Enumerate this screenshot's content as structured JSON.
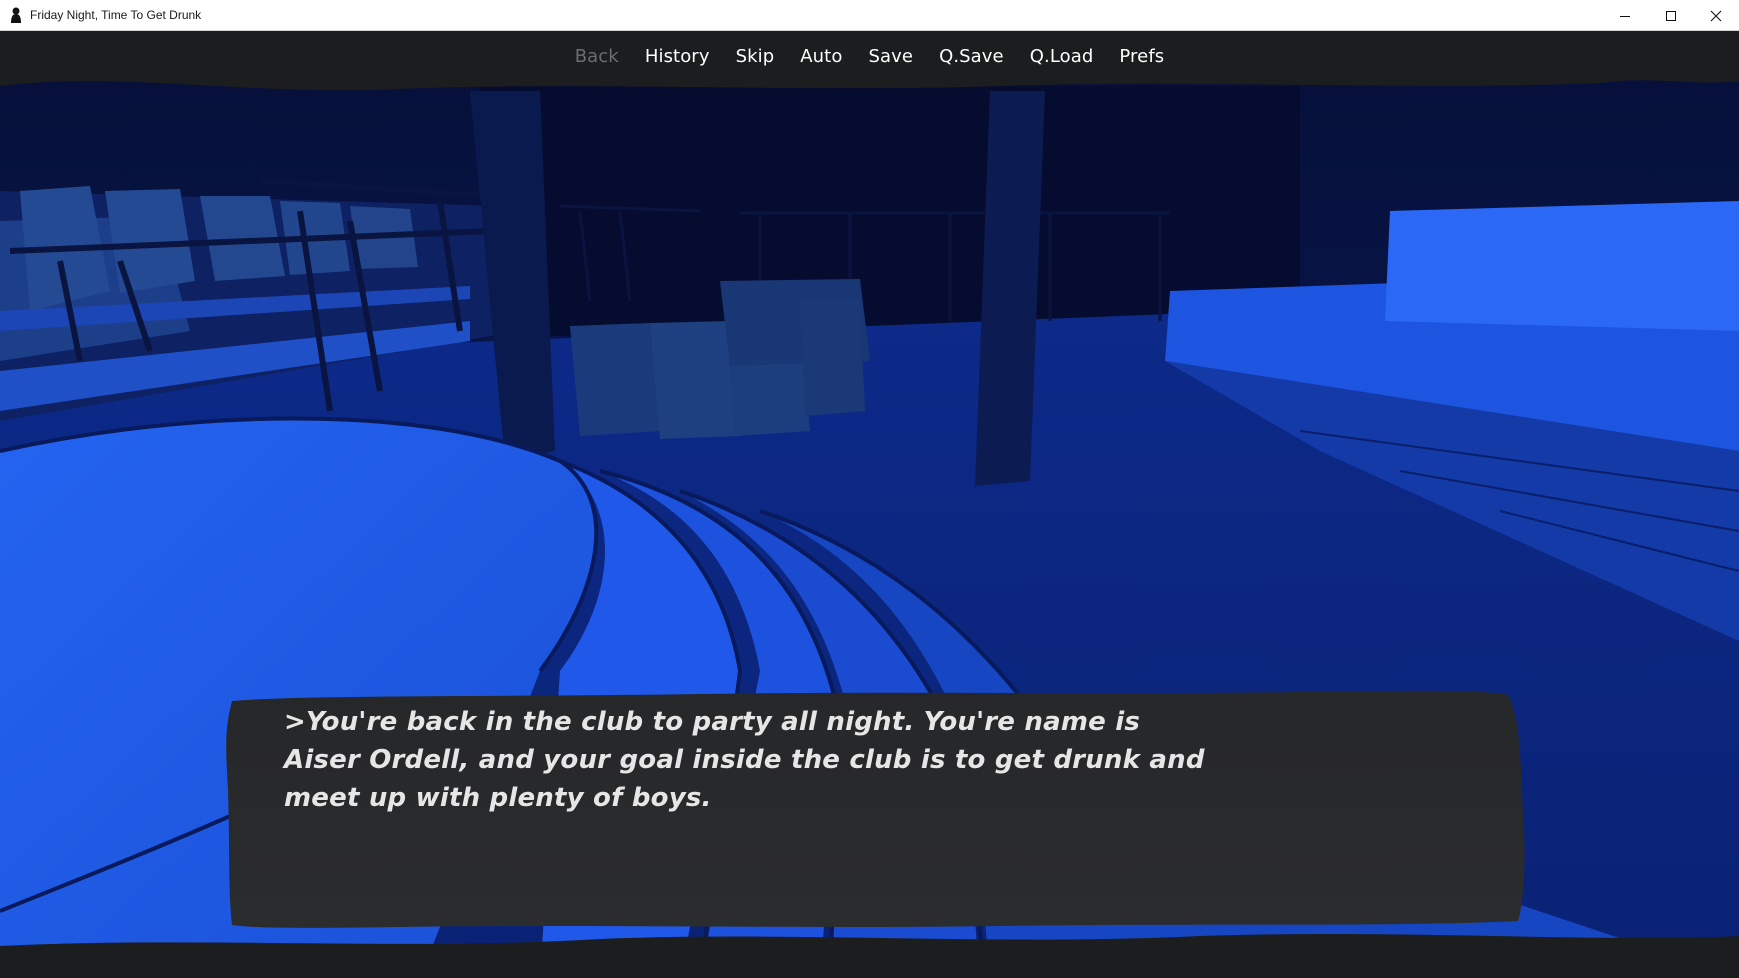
{
  "window": {
    "title": "Friday Night, Time To Get Drunk",
    "icons": {
      "app": "app-silhouette-icon",
      "minimize": "minimize-icon",
      "maximize": "maximize-icon",
      "close": "close-icon"
    }
  },
  "quick_menu": {
    "items": [
      {
        "label": "Back",
        "enabled": false
      },
      {
        "label": "History",
        "enabled": true
      },
      {
        "label": "Skip",
        "enabled": true
      },
      {
        "label": "Auto",
        "enabled": true
      },
      {
        "label": "Save",
        "enabled": true
      },
      {
        "label": "Q.Save",
        "enabled": true
      },
      {
        "label": "Q.Load",
        "enabled": true
      },
      {
        "label": "Prefs",
        "enabled": true
      }
    ]
  },
  "dialogue": {
    "text": ">You're back in the club to party all night. You're name is Aiser Ordell, and your goal inside the club is to get drunk and meet up with plenty of boys."
  },
  "colors": {
    "accent_blue": "#1f5ee8",
    "dark_navy": "#0a1640",
    "dialogue_box": "#2a2b2d",
    "menu_text": "#ffffff",
    "menu_disabled": "#6d6d6d"
  }
}
